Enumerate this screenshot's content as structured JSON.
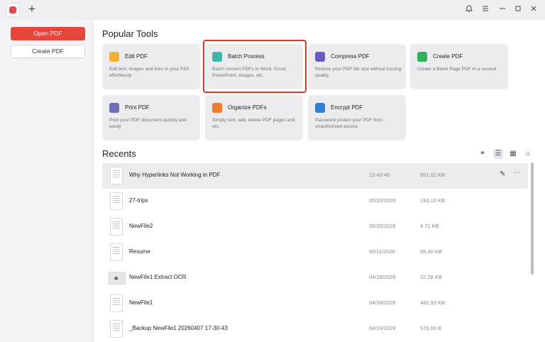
{
  "titlebar": {
    "new_tab": "+",
    "icons": [
      "bell-icon",
      "menu-icon",
      "minimize-icon",
      "maximize-icon",
      "close-icon"
    ]
  },
  "sidebar": {
    "open_pdf": "Open PDF",
    "create_pdf": "Create PDF"
  },
  "main": {
    "popular_title": "Popular Tools",
    "recents_title": "Recents",
    "tools": [
      {
        "name": "Edit PDF",
        "desc": "Edit text, images and links in your PDF effortlessly",
        "color": "#f2b233"
      },
      {
        "name": "Batch Process",
        "desc": "Batch convert PDFs to Word, Excel, PowerPoint, images, etc.",
        "color": "#3db7a8"
      },
      {
        "name": "Compress PDF",
        "desc": "Reduce your PDF file size without lossing quality.",
        "color": "#6a5ac8"
      },
      {
        "name": "Create PDF",
        "desc": "Create a Blank Page PDF in a second",
        "color": "#2fb35a"
      },
      {
        "name": "Print PDF",
        "desc": "Print your PDF document quickly and easily",
        "color": "#6d6fb9"
      },
      {
        "name": "Organize PDFs",
        "desc": "Simply sort, add, delete PDF pages and etc.",
        "color": "#f07a2e"
      },
      {
        "name": "Encrypt PDF",
        "desc": "Password protect your PDF from unauthorized access",
        "color": "#2f7fd6"
      }
    ],
    "files": [
      {
        "name": "Why Hyperlinks Not Working in PDF",
        "date": "13:40:46",
        "size": "951.02 KB"
      },
      {
        "name": "27-trips",
        "date": "05/20/2026",
        "size": "193.10 KB"
      },
      {
        "name": "NewFile2",
        "date": "05/20/2026",
        "size": "4.71 KB"
      },
      {
        "name": "Resume",
        "date": "05/11/2026",
        "size": "55.40 KB"
      },
      {
        "name": "NewFile1 Extract OCR",
        "date": "04/28/2026",
        "size": "22.28 KB"
      },
      {
        "name": "NewFile1",
        "date": "04/28/2026",
        "size": "482.93 KB"
      },
      {
        "name": "_Backup NewFile1 20260407 17-30-43",
        "date": "04/24/2026",
        "size": "576.00 B"
      }
    ]
  }
}
